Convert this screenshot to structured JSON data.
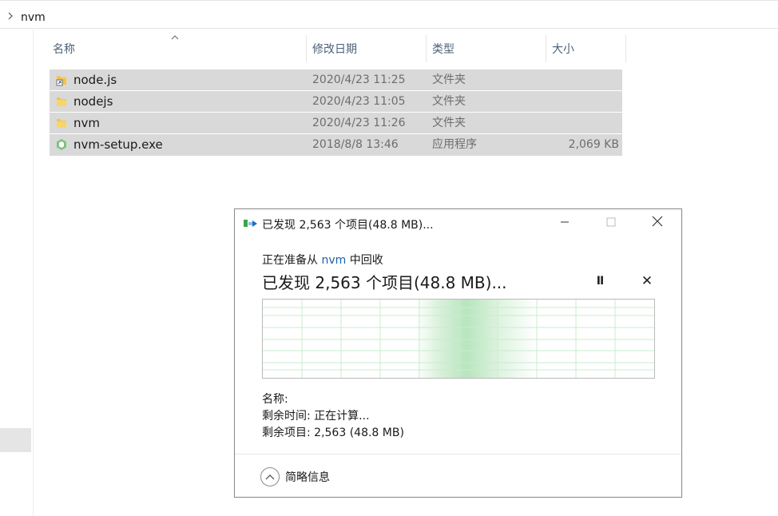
{
  "breadcrumb": {
    "path": "nvm"
  },
  "columns": {
    "name": "名称",
    "date": "修改日期",
    "type": "类型",
    "size": "大小"
  },
  "files": [
    {
      "name": "node.js",
      "date": "2020/4/23 11:25",
      "type": "文件夹",
      "size": "",
      "icon": "shortcut-folder-icon"
    },
    {
      "name": "nodejs",
      "date": "2020/4/23 11:05",
      "type": "文件夹",
      "size": "",
      "icon": "folder-icon"
    },
    {
      "name": "nvm",
      "date": "2020/4/23 11:26",
      "type": "文件夹",
      "size": "",
      "icon": "folder-icon"
    },
    {
      "name": "nvm-setup.exe",
      "date": "2018/8/8 13:46",
      "type": "应用程序",
      "size": "2,069 KB",
      "icon": "installer-icon"
    }
  ],
  "dialog": {
    "title": "已发现 2,563 个项目(48.8 MB)...",
    "status_prefix": "正在准备从",
    "status_folder": "nvm",
    "status_suffix": "中回收",
    "heading": "已发现 2,563 个项目(48.8 MB)...",
    "pause_label": "II",
    "cancel_label": "✕",
    "progress": 0.0,
    "detail_name": "名称:",
    "detail_time": "剩余时间: 正在计算...",
    "detail_items": "剩余项目: 2,563 (48.8 MB)",
    "less_details": "简略信息",
    "colors": {
      "accent": "#1a5fb4",
      "graph_fill": "#bfe6c3",
      "graph_grid": "#c9eccd"
    }
  }
}
